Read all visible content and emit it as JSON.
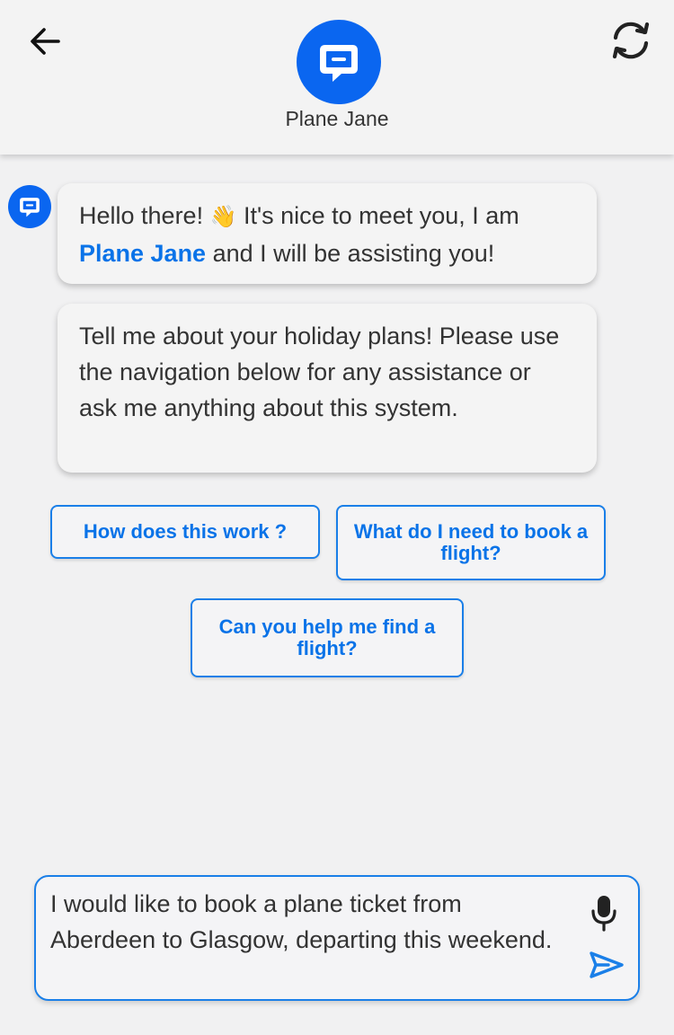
{
  "header": {
    "bot_name": "Plane Jane",
    "back_icon": "arrow-left-icon",
    "refresh_icon": "refresh-icon",
    "avatar_icon": "chat-bubble-icon",
    "accent_color": "#0a66f0"
  },
  "messages": [
    {
      "sender": "bot",
      "parts": {
        "before": "Hello there! ",
        "emoji": "👋",
        "middle": " It's nice to meet you, I am ",
        "highlight": "Plane Jane",
        "after": " and I will be assisting you!"
      }
    },
    {
      "sender": "bot",
      "text": "Tell me about your holiday plans! Please use the navigation below for any assistance or ask me anything about this system."
    }
  ],
  "suggestions": [
    {
      "label": "How does this work ?"
    },
    {
      "label": "What do I need to book a flight?"
    },
    {
      "label": "Can you help me find a flight?"
    }
  ],
  "composer": {
    "value": "I would like to book a plane ticket from Aberdeen to Glasgow, departing this weekend.",
    "mic_icon": "microphone-icon",
    "send_icon": "send-icon"
  }
}
